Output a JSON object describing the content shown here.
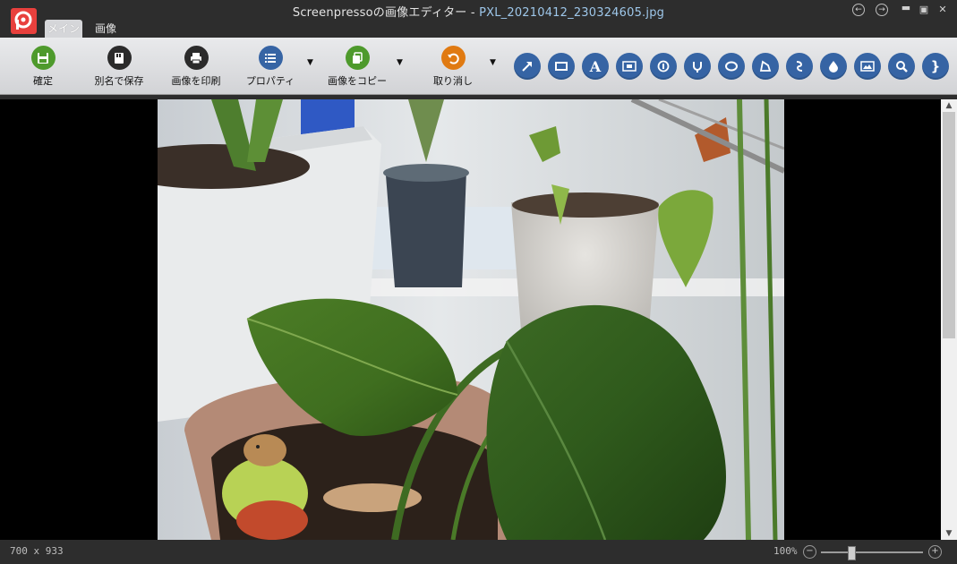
{
  "window": {
    "app_title": "Screenpressoの画像エディター",
    "separator": "-",
    "file_name": "PXL_20210412_230324605.jpg"
  },
  "tabs": [
    {
      "label": "メイン",
      "active": true
    },
    {
      "label": "画像",
      "active": false
    }
  ],
  "ribbon": {
    "buttons": [
      {
        "label": "確定",
        "icon": "save-icon",
        "color": "#4e9a2c"
      },
      {
        "label": "別名で保存",
        "icon": "save-as-icon",
        "color": "#2b2b2b"
      },
      {
        "label": "画像を印刷",
        "icon": "printer-icon",
        "color": "#2b2b2b"
      },
      {
        "label": "プロパティ",
        "icon": "list-icon",
        "color": "#3664a4"
      },
      {
        "label": "画像をコピー",
        "icon": "copy-icon",
        "color": "#4e9a2c"
      },
      {
        "label": "取り消し",
        "icon": "undo-icon",
        "color": "#e07a12"
      }
    ],
    "tools": [
      "arrow-icon",
      "rectangle-icon",
      "text-icon",
      "callout-icon",
      "step-number-icon",
      "magnet-icon",
      "ellipse-icon",
      "polygon-icon",
      "freehand-icon",
      "blur-drop-icon",
      "image-icon",
      "magnifier-icon",
      "brace-icon"
    ],
    "tool_color": "#3664a4"
  },
  "status": {
    "dimensions": "700 x 933",
    "zoom": "100%",
    "zoom_minus": "−",
    "zoom_plus": "+",
    "zoom_level_fraction": 0.3
  }
}
